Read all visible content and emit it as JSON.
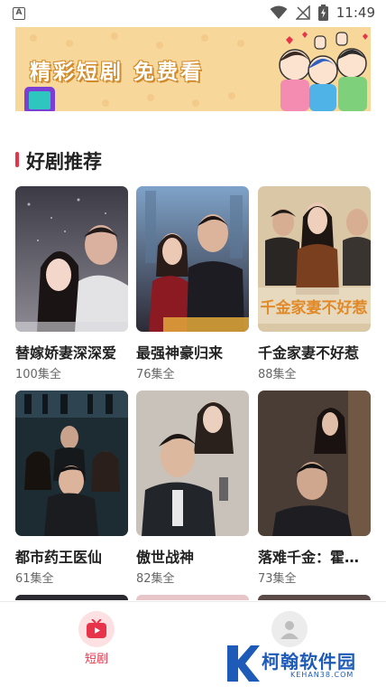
{
  "status_bar": {
    "time": "11:49",
    "notification_letter": "A"
  },
  "banner": {
    "text": "精彩短剧 免费看"
  },
  "section": {
    "title": "好剧推荐"
  },
  "dramas": [
    {
      "title": "替嫁娇妻深深爱",
      "episodes": "100集全"
    },
    {
      "title": "最强神豪归来",
      "episodes": "76集全"
    },
    {
      "title": "千金家妻不好惹",
      "episodes": "88集全"
    },
    {
      "title": "都市药王医仙",
      "episodes": "61集全"
    },
    {
      "title": "傲世战神",
      "episodes": "82集全"
    },
    {
      "title": "落难千金：霍…",
      "episodes": "73集全"
    }
  ],
  "poster_texts": {
    "poster3_caption": "千金家妻不好惹"
  },
  "bottom_nav": {
    "items": [
      {
        "label": "短剧",
        "icon": "play-tv-icon",
        "active": true
      },
      {
        "label": "",
        "icon": "user-icon",
        "active": false
      }
    ]
  },
  "watermark": {
    "name": "柯翰软件园",
    "url": "KEHAN38.COM"
  },
  "colors": {
    "accent": "#e8344a",
    "banner_bg": "#f7d79a",
    "watermark": "#1e5bb8"
  }
}
